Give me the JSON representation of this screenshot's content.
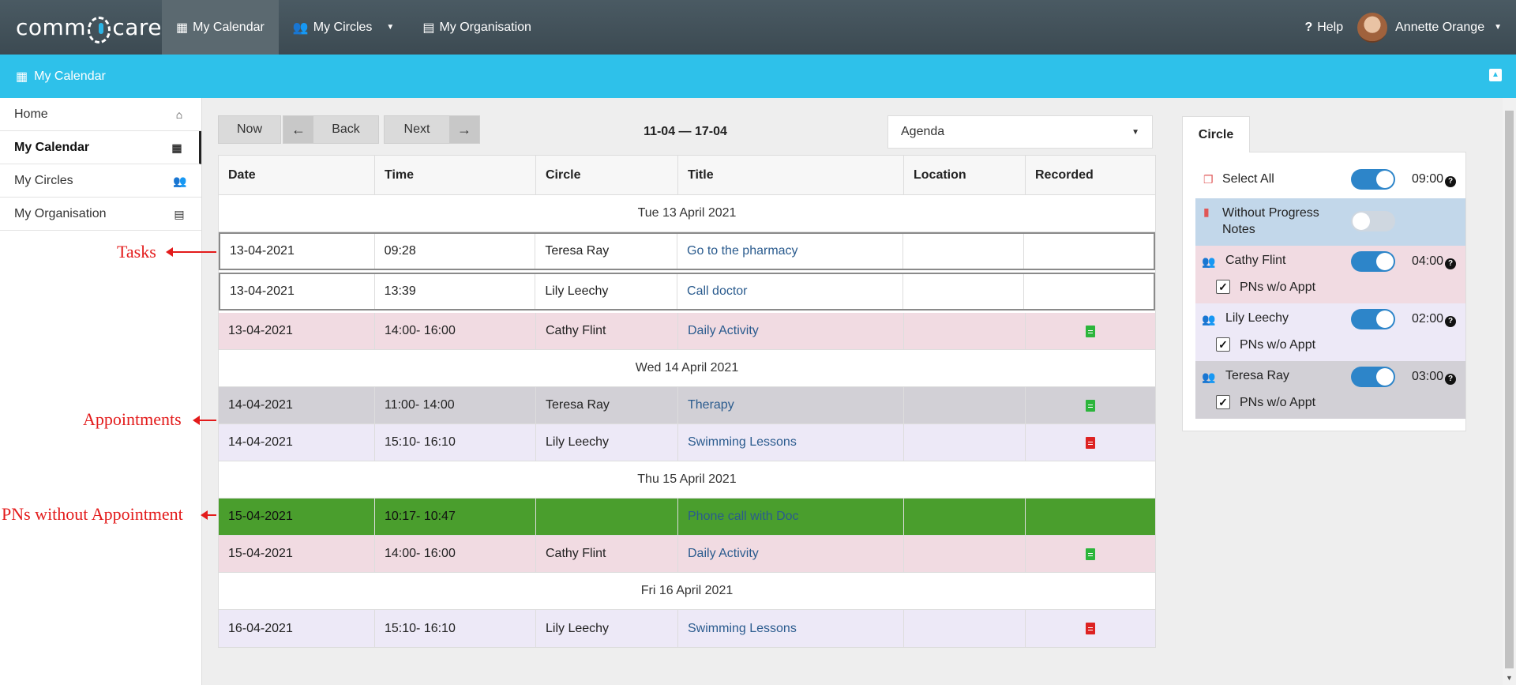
{
  "app": {
    "logo": "comm care"
  },
  "topnav": {
    "items": [
      {
        "label": "My Calendar",
        "icon": "calendar-icon"
      },
      {
        "label": "My Circles",
        "icon": "users-icon"
      },
      {
        "label": "My Organisation",
        "icon": "building-icon"
      }
    ],
    "help": "Help",
    "user": "Annette Orange"
  },
  "subbar": {
    "title": "My Calendar"
  },
  "sidebar": {
    "items": [
      {
        "label": "Home",
        "icon": "home-icon"
      },
      {
        "label": "My Calendar",
        "icon": "calendar-icon"
      },
      {
        "label": "My Circles",
        "icon": "users-icon"
      },
      {
        "label": "My Organisation",
        "icon": "building-icon"
      }
    ]
  },
  "annotations": {
    "tasks": "Tasks",
    "appointments": "Appointments",
    "pns": "PNs without Appointment"
  },
  "toolbar": {
    "now": "Now",
    "back": "Back",
    "next": "Next",
    "range": "11-04 — 17-04",
    "view": "Agenda"
  },
  "table": {
    "headers": {
      "date": "Date",
      "time": "Time",
      "circle": "Circle",
      "title": "Title",
      "location": "Location",
      "recorded": "Recorded"
    },
    "days": [
      "Tue 13 April 2021",
      "Wed 14 April 2021",
      "Thu 15 April 2021",
      "Fri 16 April 2021"
    ],
    "rows": [
      {
        "date": "13-04-2021",
        "time": "09:28",
        "circle": "Teresa Ray",
        "title": "Go to the pharmacy"
      },
      {
        "date": "13-04-2021",
        "time": "13:39",
        "circle": "Lily Leechy",
        "title": "Call doctor"
      },
      {
        "date": "13-04-2021",
        "time": "14:00- 16:00",
        "circle": "Cathy Flint",
        "title": "Daily Activity"
      },
      {
        "date": "14-04-2021",
        "time": "11:00- 14:00",
        "circle": "Teresa Ray",
        "title": "Therapy"
      },
      {
        "date": "14-04-2021",
        "time": "15:10- 16:10",
        "circle": "Lily Leechy",
        "title": "Swimming Lessons"
      },
      {
        "date": "15-04-2021",
        "time": "10:17- 10:47",
        "circle": "",
        "title": "Phone call with Doc"
      },
      {
        "date": "15-04-2021",
        "time": "14:00- 16:00",
        "circle": "Cathy Flint",
        "title": "Daily Activity"
      },
      {
        "date": "16-04-2021",
        "time": "15:10- 16:10",
        "circle": "Lily Leechy",
        "title": "Swimming Lessons"
      }
    ]
  },
  "panel": {
    "tab": "Circle",
    "select_all": "Select All",
    "select_all_time": "09:00",
    "without_pn": "Without Progress Notes",
    "circles": [
      {
        "name": "Cathy Flint",
        "time": "04:00",
        "pn_label": "PNs w/o Appt"
      },
      {
        "name": "Lily Leechy",
        "time": "02:00",
        "pn_label": "PNs w/o Appt"
      },
      {
        "name": "Teresa Ray",
        "time": "03:00",
        "pn_label": "PNs w/o Appt"
      }
    ]
  },
  "colors": {
    "nav": "#3f4e56",
    "accent": "#2ec1ea",
    "pink": "#f1dbe2",
    "grey": "#d2d0d6",
    "lavender": "#ede9f7",
    "green": "#4a9e2d",
    "toggle_on": "#2d85c9"
  }
}
